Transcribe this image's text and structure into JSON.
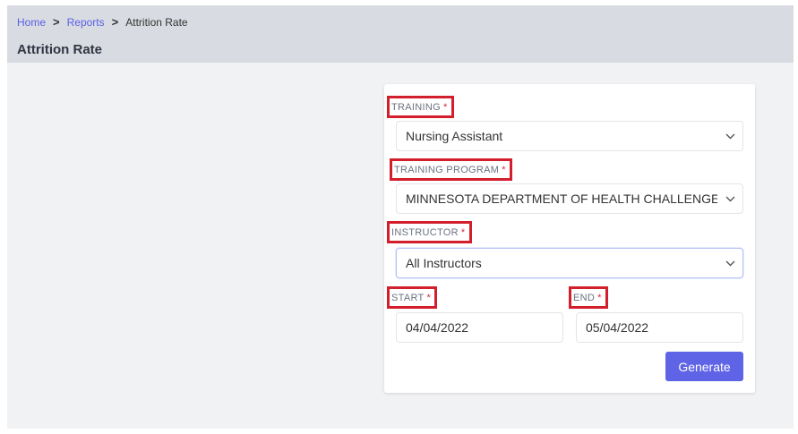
{
  "breadcrumb": {
    "home": "Home",
    "reports": "Reports",
    "current": "Attrition Rate",
    "separator": ">"
  },
  "page": {
    "title": "Attrition Rate"
  },
  "form": {
    "training": {
      "label": "TRAINING",
      "required": "*",
      "value": "Nursing Assistant"
    },
    "training_program": {
      "label": "TRAINING PROGRAM",
      "required": "*",
      "value": "MINNESOTA DEPARTMENT OF HEALTH CHALLENGE ("
    },
    "instructor": {
      "label": "INSTRUCTOR",
      "required": "*",
      "value": "All Instructors"
    },
    "start": {
      "label": "START",
      "required": "*",
      "value": "04/04/2022"
    },
    "end": {
      "label": "END",
      "required": "*",
      "value": "05/04/2022"
    },
    "generate_label": "Generate"
  },
  "icons": {
    "dropdown": "chevron-down-icon"
  },
  "colors": {
    "accent": "#5f63e6",
    "link": "#5b5fe6",
    "required": "#e0243a",
    "highlight": "#d21f2b",
    "header_bg": "#d8dbe1",
    "page_bg": "#f1f2f4"
  }
}
